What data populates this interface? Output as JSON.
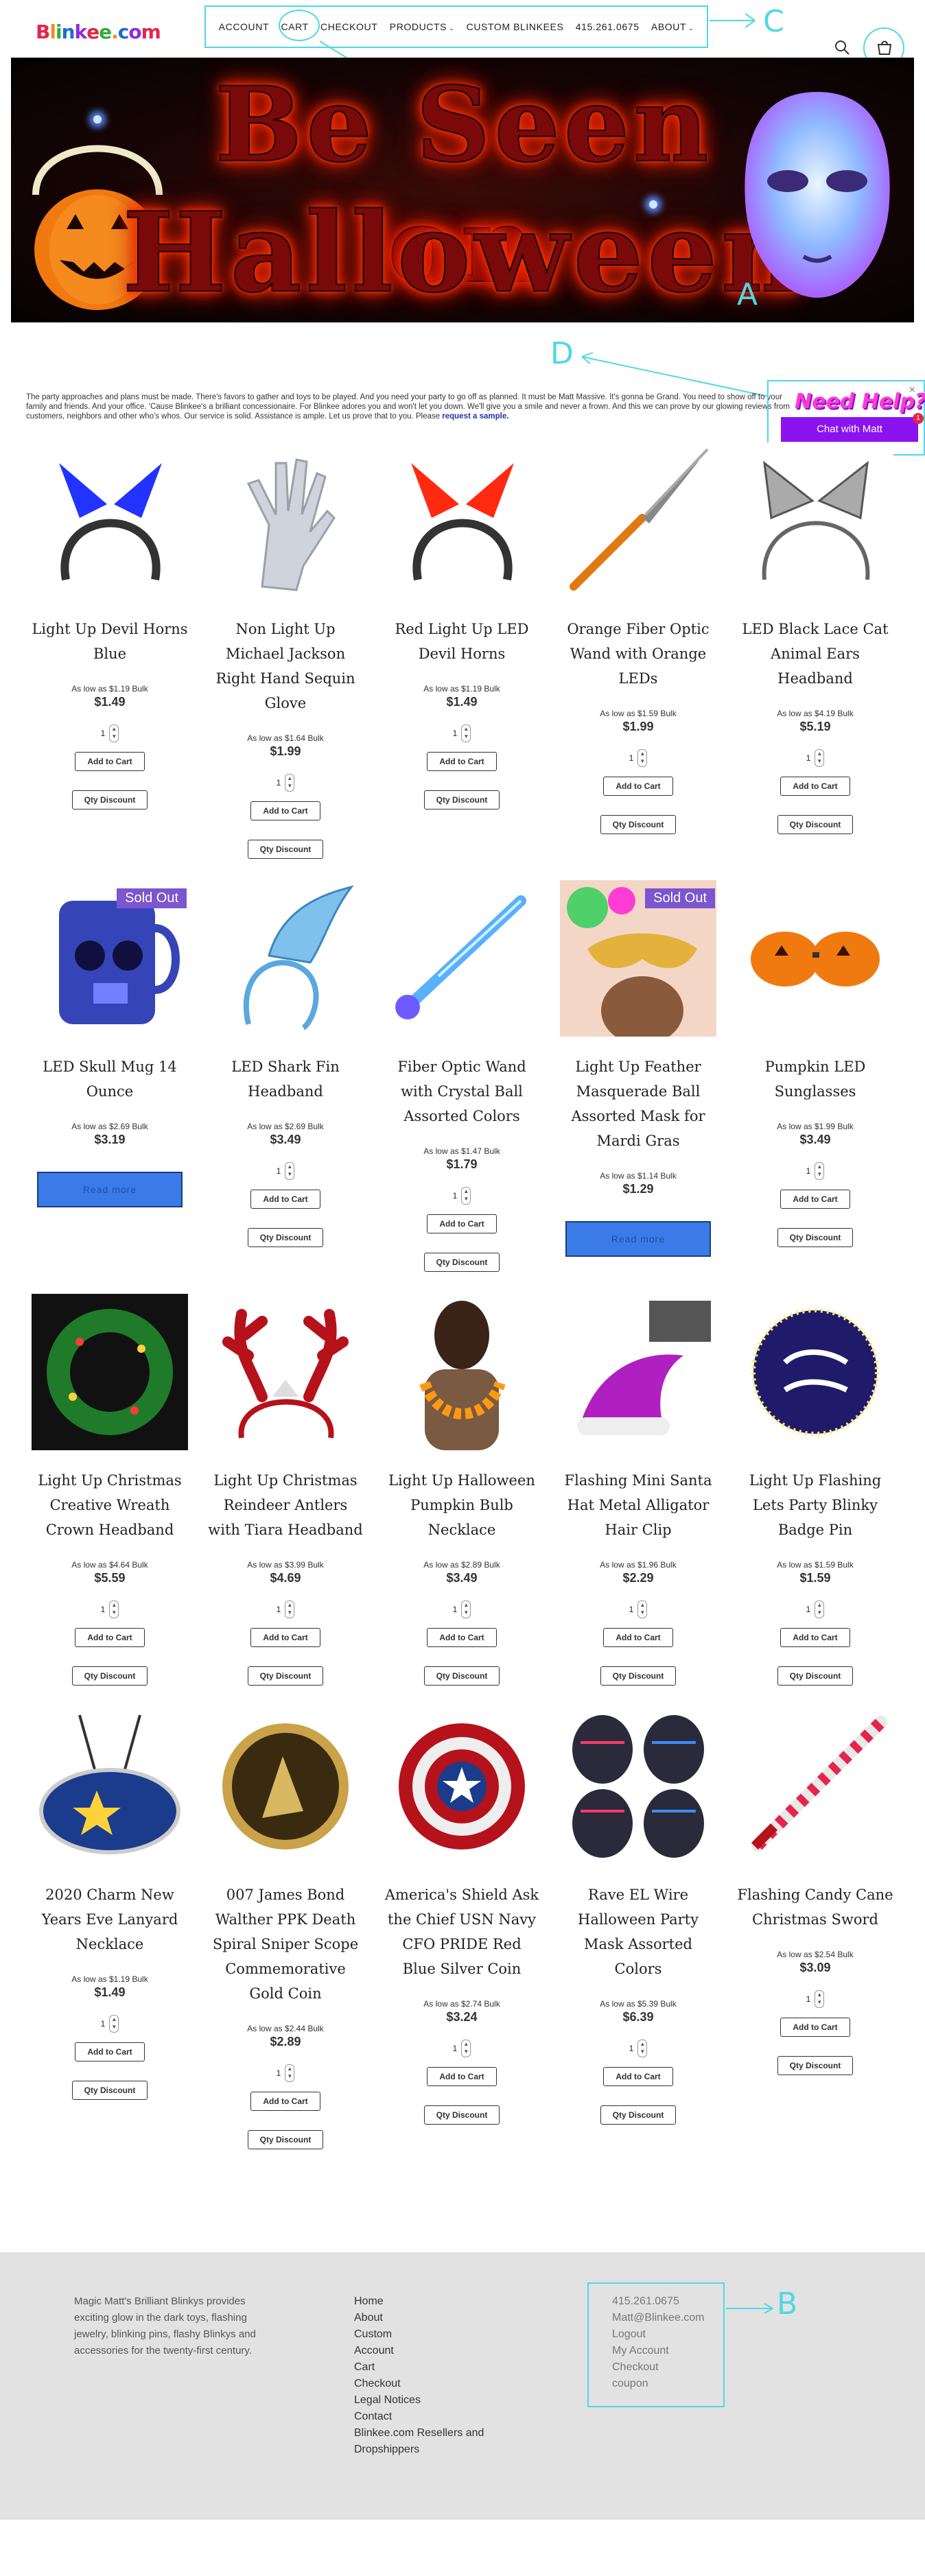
{
  "header": {
    "logo": "Blinkee.com",
    "nav": [
      "ACCOUNT",
      "CART",
      "CHECKOUT",
      "PRODUCTS",
      "CUSTOM BLINKEES",
      "415.261.0675",
      "ABOUT"
    ],
    "annotation": "C"
  },
  "banner": {
    "line1": "Be Seen on",
    "line2": "Halloween",
    "annotation": "A"
  },
  "intro": {
    "text": "The party approaches and plans must be made. There's favors to gather and toys to be played. And you need your party to go off as planned. It must be Matt Massive. It's gonna be Grand. You need to show off to your family and friends. And your office. 'Cause Blinkee's a brilliant concessionaire. For Blinkee adores you and won't let you down. We'll give you a smile and never a frown. And this we can prove by our glowing reviews from customers, neighbors and other who's whos. Our service is solid. Assistance is ample. Let us prove that to you. Please",
    "link": "request a sample.",
    "annotation": "D"
  },
  "chat": {
    "title": "Need Help?",
    "button": "Chat with Matt",
    "badge": "1",
    "close": "×"
  },
  "labels": {
    "add_to_cart": "Add to Cart",
    "qty_discount": "Qty Discount",
    "read_more": "Read more",
    "qty_default": "1",
    "sold_out": "Sold Out"
  },
  "products": [
    {
      "name": "Light Up Devil Horns Blue",
      "bulk": "As low as $1.19 Bulk",
      "price": "$1.49",
      "sold_out": false,
      "icon": "devil-horns-blue"
    },
    {
      "name": "Non Light Up Michael Jackson Right Hand Sequin Glove",
      "bulk": "As low as $1.64 Bulk",
      "price": "$1.99",
      "sold_out": false,
      "icon": "sequin-glove"
    },
    {
      "name": "Red Light Up LED Devil Horns",
      "bulk": "As low as $1.19 Bulk",
      "price": "$1.49",
      "sold_out": false,
      "icon": "devil-horns-red"
    },
    {
      "name": "Orange Fiber Optic Wand with Orange LEDs",
      "bulk": "As low as $1.59 Bulk",
      "price": "$1.99",
      "sold_out": false,
      "icon": "fiber-wand-orange"
    },
    {
      "name": "LED Black Lace Cat Animal Ears Headband",
      "bulk": "As low as $4.19 Bulk",
      "price": "$5.19",
      "sold_out": false,
      "icon": "cat-ears"
    },
    {
      "name": "LED Skull Mug 14 Ounce",
      "bulk": "As low as $2.69 Bulk",
      "price": "$3.19",
      "sold_out": true,
      "icon": "skull-mug"
    },
    {
      "name": "LED Shark Fin Headband",
      "bulk": "As low as $2.69 Bulk",
      "price": "$3.49",
      "sold_out": false,
      "icon": "shark-fin"
    },
    {
      "name": "Fiber Optic Wand with Crystal Ball Assorted Colors",
      "bulk": "As low as $1.47 Bulk",
      "price": "$1.79",
      "sold_out": false,
      "icon": "crystal-wand"
    },
    {
      "name": "Light Up Feather Masquerade Ball Assorted Mask for Mardi Gras",
      "bulk": "As low as $1.14 Bulk",
      "price": "$1.29",
      "sold_out": true,
      "icon": "feather-mask"
    },
    {
      "name": "Pumpkin LED Sunglasses",
      "bulk": "As low as $1.99 Bulk",
      "price": "$3.49",
      "sold_out": false,
      "icon": "pumpkin-glasses"
    },
    {
      "name": "Light Up Christmas Creative Wreath Crown Headband",
      "bulk": "As low as $4.64 Bulk",
      "price": "$5.59",
      "sold_out": false,
      "icon": "wreath"
    },
    {
      "name": "Light Up Christmas Reindeer Antlers with Tiara Headband",
      "bulk": "As low as $3.99 Bulk",
      "price": "$4.69",
      "sold_out": false,
      "icon": "antlers"
    },
    {
      "name": "Light Up Halloween Pumpkin Bulb Necklace",
      "bulk": "As low as $2.89 Bulk",
      "price": "$3.49",
      "sold_out": false,
      "icon": "pumpkin-necklace"
    },
    {
      "name": "Flashing Mini Santa Hat Metal Alligator Hair Clip",
      "bulk": "As low as $1.96 Bulk",
      "price": "$2.29",
      "sold_out": false,
      "icon": "santa-hat"
    },
    {
      "name": "Light Up Flashing Lets Party Blinky Badge Pin",
      "bulk": "As low as $1.59 Bulk",
      "price": "$1.59",
      "sold_out": false,
      "icon": "party-badge"
    },
    {
      "name": "2020 Charm New Years Eve Lanyard Necklace",
      "bulk": "As low as $1.19 Bulk",
      "price": "$1.49",
      "sold_out": false,
      "icon": "charm-2020"
    },
    {
      "name": "007 James Bond Walther PPK Death Spiral Sniper Scope Commemorative Gold Coin",
      "bulk": "As low as $2.44 Bulk",
      "price": "$2.89",
      "sold_out": false,
      "icon": "gold-coin"
    },
    {
      "name": "America's Shield Ask the Chief USN Navy CFO PRIDE Red Blue Silver Coin",
      "bulk": "As low as $2.74 Bulk",
      "price": "$3.24",
      "sold_out": false,
      "icon": "shield-coin"
    },
    {
      "name": "Rave EL Wire Halloween Party Mask Assorted Colors",
      "bulk": "As low as $5.39 Bulk",
      "price": "$6.39",
      "sold_out": false,
      "icon": "rave-masks"
    },
    {
      "name": "Flashing Candy Cane Christmas Sword",
      "bulk": "As low as $2.54 Bulk",
      "price": "$3.09",
      "sold_out": false,
      "icon": "candy-sword"
    }
  ],
  "footer": {
    "about": "Magic Matt's Brilliant Blinkys provides exciting glow in the dark toys, flashing jewelry, blinking pins, flashy Blinkys and accessories for the twenty-first century.",
    "links": [
      "Home",
      "About",
      "Custom",
      "Account",
      "Cart",
      "Checkout",
      "Legal Notices",
      "Contact",
      "Blinkee.com Resellers and Dropshippers"
    ],
    "contact": [
      "415.261.0675",
      "Matt@Blinkee.com",
      "Logout",
      "My Account",
      "Checkout",
      "coupon"
    ],
    "annotation": "B"
  },
  "colors": {
    "annotation": "#4fd8e6",
    "chat_button": "#8a13f0",
    "sold_badge": "#7b56cf",
    "read_more": "#3b7be8",
    "footer_bg": "#e2e2e2"
  }
}
